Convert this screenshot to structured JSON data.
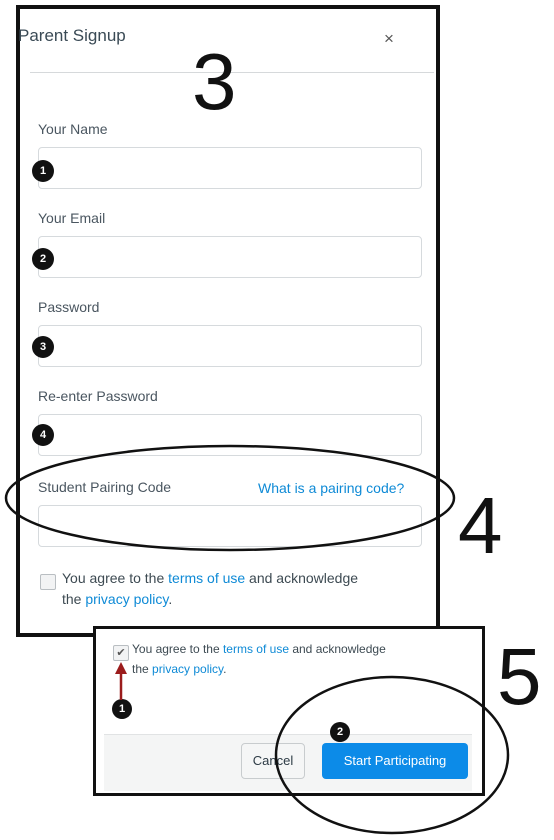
{
  "dialog": {
    "title": "Parent Signup",
    "close_glyph": "×",
    "annotation_number": "3"
  },
  "fields": [
    {
      "label": "Your Name",
      "value": "",
      "badge": "1"
    },
    {
      "label": "Your Email",
      "value": "",
      "badge": "2"
    },
    {
      "label": "Password",
      "value": "",
      "badge": "3"
    },
    {
      "label": "Re-enter Password",
      "value": "",
      "badge": "4"
    }
  ],
  "pairing": {
    "label": "Student Pairing Code",
    "help_link": "What is a pairing code?",
    "value": "",
    "annotation_number": "4"
  },
  "agreement": {
    "prefix": "You agree to the ",
    "terms_link": "terms of use",
    "middle": " and acknowledge",
    "line2_prefix": "the ",
    "privacy_link": "privacy policy",
    "suffix": ".",
    "checked": false
  },
  "panel2": {
    "annotation_number": "5",
    "agreement": {
      "prefix": "You agree to the ",
      "terms_link": "terms of use",
      "middle": " and acknowledge",
      "line2_prefix": "the ",
      "privacy_link": "privacy policy",
      "suffix": ".",
      "checked": true,
      "checkmark": "✔"
    },
    "badge_checkbox": "1",
    "badge_button": "2",
    "cancel_label": "Cancel",
    "start_label": "Start Participating"
  },
  "icons": {
    "close": "close-icon",
    "check": "checkmark-icon",
    "arrow": "arrow-up-icon"
  },
  "colors": {
    "link": "#0e8ad6",
    "primary_button": "#0c8be8",
    "arrow": "#9b1c1c",
    "annotation": "#111111"
  }
}
